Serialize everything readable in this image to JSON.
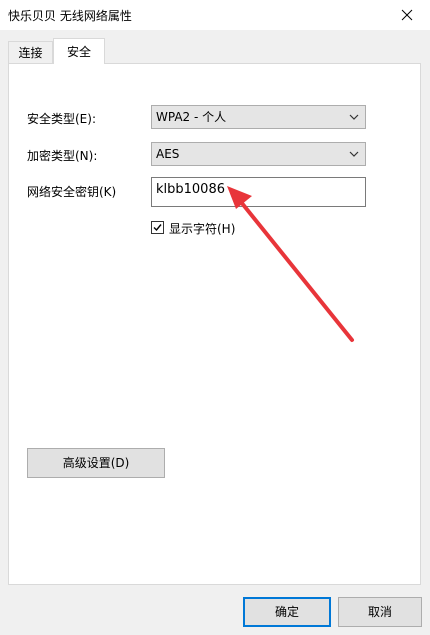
{
  "window": {
    "title": "快乐贝贝 无线网络属性",
    "close_glyph": "✕"
  },
  "tabs": [
    {
      "label": "连接"
    },
    {
      "label": "安全"
    }
  ],
  "security": {
    "type_label": "安全类型(E):",
    "type_value": "WPA2 - 个人",
    "encryption_label": "加密类型(N):",
    "encryption_value": "AES",
    "key_label": "网络安全密钥(K)",
    "key_value": "klbb10086",
    "show_chars_label": "显示字符(H)",
    "show_chars_checked": true
  },
  "buttons": {
    "advanced": "高级设置(D)",
    "ok": "确定",
    "cancel": "取消"
  },
  "colors": {
    "annotation_arrow": "#e8353a",
    "focus_border": "#0078d7"
  }
}
